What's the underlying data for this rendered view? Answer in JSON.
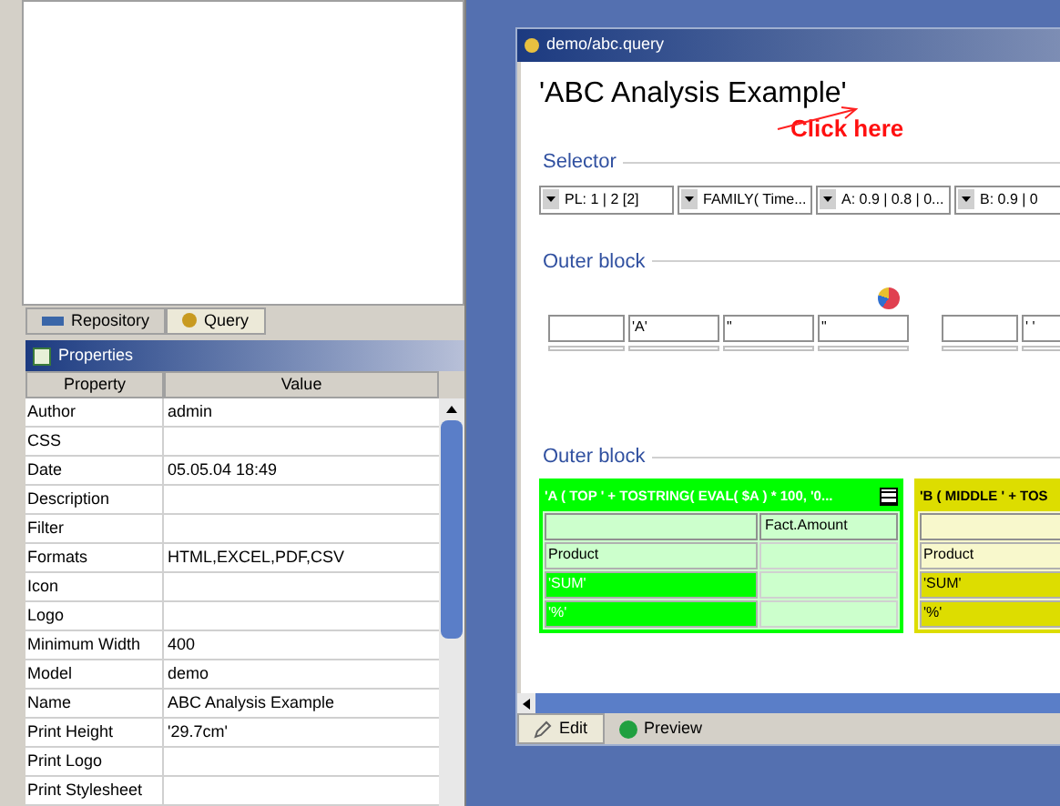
{
  "left_tabs": [
    {
      "label": "Repository",
      "selected": false
    },
    {
      "label": "Query",
      "selected": true
    }
  ],
  "properties": {
    "title": "Properties",
    "columns": [
      "Property",
      "Value"
    ],
    "rows": [
      {
        "property": "Author",
        "value": "admin"
      },
      {
        "property": "CSS"
      },
      {
        "property": "Date",
        "value": "05.05.04 18:49"
      },
      {
        "property": "Description"
      },
      {
        "property": "Filter"
      },
      {
        "property": "Formats",
        "value": "HTML,EXCEL,PDF,CSV"
      },
      {
        "property": "Icon"
      },
      {
        "property": "Logo"
      },
      {
        "property": "Minimum Width",
        "value": "400"
      },
      {
        "property": "Model",
        "value": "demo"
      },
      {
        "property": "Name",
        "value": "ABC Analysis Example"
      },
      {
        "property": "Print Height",
        "value": "'29.7cm'"
      },
      {
        "property": "Print Logo"
      },
      {
        "property": "Print Stylesheet"
      }
    ]
  },
  "editor": {
    "title": "demo/abc.query",
    "heading": "'ABC Analysis Example'",
    "annotation": "Click here",
    "selector": {
      "label": "Selector",
      "dropdowns": [
        "PL: 1 | 2 [2]",
        "FAMILY( Time...",
        "A: 0.9 | 0.8 | 0...",
        "B: 0.9 | 0"
      ]
    },
    "outer_block_1": {
      "label": "Outer block",
      "groups": [
        [
          "'A'",
          "\"",
          "\""
        ],
        [
          "' '"
        ]
      ]
    },
    "outer_block_2": {
      "label": "Outer block",
      "tables": [
        {
          "header": "'A ( TOP ' + TOSTRING( EVAL( $A ) * 100, '0...",
          "color": "#00ff00",
          "column_header": "Fact.Amount",
          "rows": [
            "Product",
            "'SUM'",
            "'%'"
          ]
        },
        {
          "header": "'B ( MIDDLE ' + TOS",
          "color": "#dddd00",
          "rows": [
            "Product",
            "'SUM'",
            "'%'"
          ]
        }
      ]
    },
    "bottom_tabs": [
      {
        "label": "Edit",
        "selected": true
      },
      {
        "label": "Preview",
        "selected": false
      }
    ]
  }
}
